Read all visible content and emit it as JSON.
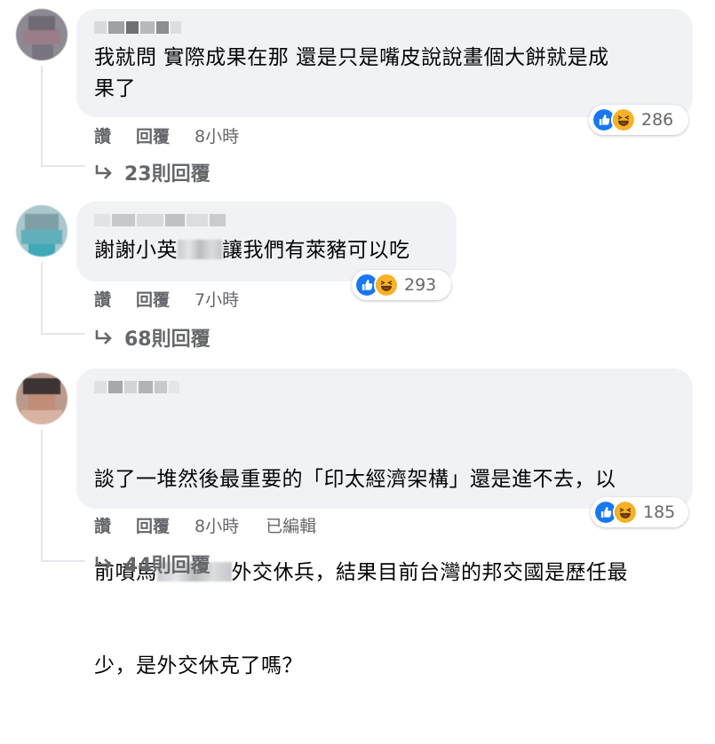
{
  "comments": [
    {
      "text": "我就問 實際成果在那 還是只是嘴皮說說畫個大餅就是成\n果了",
      "reaction_count": "286",
      "like_label": "讚",
      "reply_label": "回覆",
      "time": "8小時",
      "edited": "",
      "replies_label": "23則回覆"
    },
    {
      "text_before": "謝謝小英",
      "text_after": "讓我們有萊豬可以吃",
      "reaction_count": "293",
      "like_label": "讚",
      "reply_label": "回覆",
      "time": "7小時",
      "replies_label": "68則回覆"
    },
    {
      "text_line1": "談了一堆然後最重要的「印太經濟架構」還是進不去，以",
      "text_line2_before": "前噴馬",
      "text_line2_after": "外交休兵，結果目前台灣的邦交國是歷任最",
      "text_line3": "少，是外交休克了嗎？",
      "reaction_count": "185",
      "like_label": "讚",
      "reply_label": "回覆",
      "time": "8小時",
      "edited": "已編輯",
      "replies_label": "44則回覆"
    }
  ],
  "icons": {
    "like": "like-reaction-icon",
    "haha": "haha-reaction-icon",
    "reply_arrow": "reply-arrow-icon"
  },
  "colors": {
    "like_blue": "#1877f2",
    "haha_yellow": "#f7b125",
    "bubble_bg": "#f0f2f5",
    "muted_text": "#65676b"
  }
}
